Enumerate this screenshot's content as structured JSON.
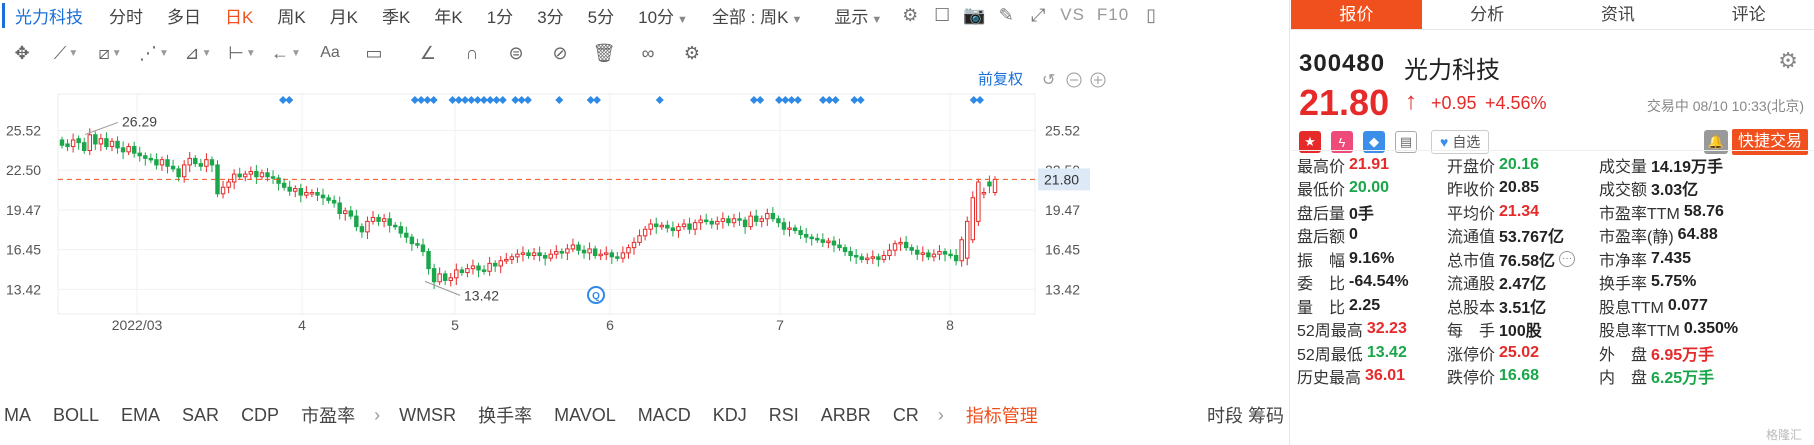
{
  "toolbar": {
    "stock_name": "光力科技",
    "periods": [
      "分时",
      "多日",
      "日K",
      "周K",
      "月K",
      "季K",
      "年K",
      "1分",
      "3分",
      "5分",
      "10分"
    ],
    "active_period": "日K",
    "all_label": "全部 : 周K",
    "display_label": "显示",
    "vs_label": "VS",
    "f10_label": "F10"
  },
  "chart": {
    "fuquan_label": "前复权",
    "y_ticks": [
      "25.52",
      "22.50",
      "19.47",
      "16.45",
      "13.42"
    ],
    "current_price_label": "21.80",
    "x_labels": [
      "2022/03",
      "4",
      "5",
      "6",
      "7",
      "8"
    ],
    "high_label": "26.29",
    "low_label": "13.42",
    "q_marker": "Q"
  },
  "chart_data": {
    "type": "candlestick",
    "y_range": [
      12.0,
      28.0
    ],
    "current_price": 21.8,
    "high_marker": 26.29,
    "low_marker": 13.42,
    "x_months": [
      "2022/03",
      "4",
      "5",
      "6",
      "7",
      "8"
    ],
    "closes": [
      24.4,
      24.3,
      24.8,
      24.6,
      24.0,
      25.2,
      24.5,
      24.9,
      24.3,
      24.7,
      24.2,
      23.9,
      24.3,
      23.8,
      23.6,
      23.4,
      23.3,
      22.9,
      23.3,
      22.8,
      22.6,
      22.0,
      22.9,
      23.4,
      23.0,
      22.8,
      23.3,
      22.9,
      20.7,
      21.2,
      21.6,
      22.2,
      22.0,
      22.2,
      22.4,
      22.0,
      22.3,
      22.0,
      21.9,
      21.5,
      21.2,
      20.9,
      21.1,
      20.6,
      20.8,
      20.8,
      20.6,
      20.4,
      20.2,
      20.0,
      19.2,
      19.4,
      19.0,
      18.2,
      17.8,
      18.6,
      18.9,
      18.6,
      18.8,
      18.3,
      18.2,
      17.7,
      17.4,
      16.9,
      16.8,
      16.3,
      15.0,
      14.0,
      14.6,
      14.1,
      14.3,
      14.9,
      14.7,
      15.0,
      15.2,
      14.9,
      14.8,
      15.4,
      15.2,
      15.6,
      15.7,
      15.9,
      16.1,
      16.2,
      16.0,
      16.2,
      16.0,
      15.8,
      16.1,
      16.3,
      16.2,
      16.5,
      16.8,
      16.4,
      16.2,
      16.5,
      16.0,
      16.1,
      16.2,
      15.9,
      15.8,
      16.2,
      16.6,
      17.0,
      17.5,
      18.0,
      18.4,
      18.2,
      18.3,
      18.1,
      17.9,
      18.2,
      18.4,
      18.0,
      18.5,
      18.7,
      18.6,
      18.4,
      18.6,
      18.8,
      18.5,
      18.8,
      18.7,
      18.2,
      19.0,
      18.6,
      18.8,
      19.2,
      18.8,
      18.5,
      18.0,
      18.1,
      17.9,
      17.6,
      17.4,
      17.3,
      17.2,
      17.0,
      17.1,
      16.8,
      16.6,
      16.3,
      16.0,
      15.9,
      15.7,
      15.8,
      15.9,
      15.7,
      16.0,
      16.4,
      16.9,
      17.0,
      16.6,
      16.4,
      16.1,
      16.2,
      15.9,
      16.1,
      16.3,
      16.1,
      16.0,
      15.6,
      17.2,
      18.6,
      20.4,
      21.6,
      20.8,
      21.3,
      21.8
    ],
    "opens": [
      24.8,
      24.5,
      24.3,
      24.9,
      24.6,
      24.0,
      25.2,
      24.5,
      24.9,
      24.3,
      24.7,
      24.2,
      23.9,
      24.3,
      23.8,
      23.6,
      23.4,
      23.3,
      22.9,
      23.3,
      22.8,
      22.6,
      22.0,
      22.9,
      23.4,
      23.0,
      22.8,
      23.3,
      22.9,
      20.7,
      21.2,
      21.6,
      22.2,
      22.0,
      22.2,
      22.4,
      22.0,
      22.3,
      22.0,
      21.9,
      21.5,
      21.2,
      20.9,
      21.1,
      20.6,
      20.8,
      20.8,
      20.6,
      20.4,
      20.2,
      20.0,
      19.2,
      19.4,
      19.0,
      18.2,
      17.8,
      18.6,
      18.9,
      18.6,
      18.8,
      18.3,
      18.2,
      17.7,
      17.4,
      16.9,
      16.8,
      16.3,
      15.0,
      14.0,
      14.6,
      14.1,
      14.3,
      14.9,
      14.7,
      15.0,
      15.2,
      14.9,
      14.8,
      15.4,
      15.2,
      15.6,
      15.7,
      15.9,
      16.1,
      16.2,
      16.0,
      16.2,
      16.0,
      15.8,
      16.1,
      16.3,
      16.2,
      16.5,
      16.8,
      16.4,
      16.2,
      16.5,
      16.0,
      16.1,
      16.2,
      15.9,
      15.8,
      16.2,
      16.6,
      17.0,
      17.5,
      18.0,
      18.4,
      18.2,
      18.3,
      18.1,
      17.9,
      18.2,
      18.4,
      18.0,
      18.5,
      18.7,
      18.6,
      18.4,
      18.6,
      18.8,
      18.5,
      18.8,
      18.7,
      18.2,
      19.0,
      18.6,
      18.8,
      19.2,
      18.8,
      18.5,
      18.0,
      18.1,
      17.9,
      17.6,
      17.4,
      17.3,
      17.2,
      17.0,
      17.1,
      16.8,
      16.6,
      16.3,
      16.0,
      15.9,
      15.7,
      15.8,
      15.9,
      15.7,
      16.0,
      16.4,
      16.9,
      17.0,
      16.6,
      16.4,
      16.1,
      16.2,
      15.9,
      16.1,
      16.3,
      16.1,
      16.0,
      15.6,
      15.8,
      17.2,
      18.6,
      20.8,
      21.6,
      20.8,
      20.2
    ]
  },
  "indicators": {
    "items": [
      "MA",
      "BOLL",
      "EMA",
      "SAR",
      "CDP",
      "市盈率"
    ],
    "items2": [
      "WMSR",
      "换手率",
      "MAVOL",
      "MACD",
      "KDJ",
      "RSI",
      "ARBR",
      "CR"
    ],
    "manager": "指标管理",
    "right_labels": "时段 筹码"
  },
  "panel": {
    "tabs": [
      "报价",
      "分析",
      "资讯",
      "评论"
    ],
    "code": "300480",
    "name": "光力科技",
    "price": "21.80",
    "change": "+0.95",
    "change_pct": "+4.56%",
    "status": "交易中 08/10 10:33(北京)",
    "watch_label": "自选",
    "quick_trade": "快捷交易"
  },
  "stats": [
    [
      {
        "l": "最高价",
        "v": "21.91",
        "c": "red"
      },
      {
        "l": "开盘价",
        "v": "20.16",
        "c": "green"
      },
      {
        "l": "成交量",
        "v": "14.19万手",
        "c": ""
      }
    ],
    [
      {
        "l": "最低价",
        "v": "20.00",
        "c": "green"
      },
      {
        "l": "昨收价",
        "v": "20.85",
        "c": ""
      },
      {
        "l": "成交额",
        "v": "3.03亿",
        "c": ""
      }
    ],
    [
      {
        "l": "盘后量",
        "v": "0手",
        "c": ""
      },
      {
        "l": "平均价",
        "v": "21.34",
        "c": "red"
      },
      {
        "l": "市盈率TTM",
        "v": "58.76",
        "c": ""
      }
    ],
    [
      {
        "l": "盘后额",
        "v": "0",
        "c": ""
      },
      {
        "l": "流通值",
        "v": "53.767亿",
        "c": ""
      },
      {
        "l": "市盈率(静)",
        "v": "64.88",
        "c": ""
      }
    ],
    [
      {
        "l": "振　幅",
        "v": "9.16%",
        "c": ""
      },
      {
        "l": "总市值",
        "v": "76.58亿",
        "c": ""
      },
      {
        "l": "市净率",
        "v": "7.435",
        "c": ""
      }
    ],
    [
      {
        "l": "委　比",
        "v": "-64.54%",
        "c": ""
      },
      {
        "l": "流通股",
        "v": "2.47亿",
        "c": ""
      },
      {
        "l": "换手率",
        "v": "5.75%",
        "c": ""
      }
    ],
    [
      {
        "l": "量　比",
        "v": "2.25",
        "c": ""
      },
      {
        "l": "总股本",
        "v": "3.51亿",
        "c": ""
      },
      {
        "l": "股息TTM",
        "v": "0.077",
        "c": ""
      }
    ],
    [
      {
        "l": "52周最高",
        "v": "32.23",
        "c": "red"
      },
      {
        "l": "每　手",
        "v": "100股",
        "c": ""
      },
      {
        "l": "股息率TTM",
        "v": "0.350%",
        "c": ""
      }
    ],
    [
      {
        "l": "52周最低",
        "v": "13.42",
        "c": "green"
      },
      {
        "l": "涨停价",
        "v": "25.02",
        "c": "red"
      },
      {
        "l": "外　盘",
        "v": "6.95万手",
        "c": "red"
      }
    ],
    [
      {
        "l": "历史最高",
        "v": "36.01",
        "c": "red"
      },
      {
        "l": "跌停价",
        "v": "16.68",
        "c": "green"
      },
      {
        "l": "内　盘",
        "v": "6.25万手",
        "c": "green"
      }
    ]
  ],
  "watermark": "格隆汇",
  "colors": {
    "up": "#e62a2a",
    "down": "#1aa64a",
    "accent": "#f0501e",
    "link": "#1a6fd8"
  }
}
